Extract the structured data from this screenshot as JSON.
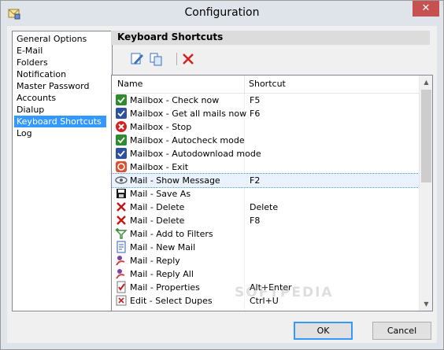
{
  "window": {
    "title": "Configuration",
    "close_glyph": "✕"
  },
  "nav": {
    "items": [
      {
        "label": "General Options",
        "selected": false
      },
      {
        "label": "E-Mail",
        "selected": false
      },
      {
        "label": "Folders",
        "selected": false
      },
      {
        "label": "Notification",
        "selected": false
      },
      {
        "label": "Master Password",
        "selected": false
      },
      {
        "label": "Accounts",
        "selected": false
      },
      {
        "label": "Dialup",
        "selected": false
      },
      {
        "label": "Keyboard Shortcuts",
        "selected": true
      },
      {
        "label": "Log",
        "selected": false
      }
    ]
  },
  "section": {
    "title": "Keyboard Shortcuts"
  },
  "toolbar": {
    "edit_icon": "edit-icon",
    "copy_icon": "copy-icon",
    "delete_icon": "delete-icon"
  },
  "table": {
    "columns": [
      "Name",
      "Shortcut"
    ],
    "rows": [
      {
        "name": "Mailbox - Check now",
        "shortcut": "F5",
        "icon": "check-mail-icon",
        "color": "#2e8b2e"
      },
      {
        "name": "Mailbox - Get all mails now",
        "shortcut": "F6",
        "icon": "get-mail-icon",
        "color": "#2f4f9f"
      },
      {
        "name": "Mailbox - Stop",
        "shortcut": "",
        "icon": "stop-icon",
        "color": "#d42020"
      },
      {
        "name": "Mailbox - Autocheck mode",
        "shortcut": "",
        "icon": "autocheck-icon",
        "color": "#2e8b2e"
      },
      {
        "name": "Mailbox - Autodownload mode",
        "shortcut": "",
        "icon": "autodownload-icon",
        "color": "#2f4f9f"
      },
      {
        "name": "Mailbox - Exit",
        "shortcut": "",
        "icon": "exit-icon",
        "color": "#e05030"
      },
      {
        "name": "Mail - Show Message",
        "shortcut": "F2",
        "icon": "show-message-icon",
        "color": "#606060",
        "focused": true
      },
      {
        "name": "Mail - Save As",
        "shortcut": "",
        "icon": "save-icon",
        "color": "#1a1a1a"
      },
      {
        "name": "Mail - Delete",
        "shortcut": "Delete",
        "icon": "delete-icon",
        "color": "#c01818"
      },
      {
        "name": "Mail - Delete",
        "shortcut": "F8",
        "icon": "delete-icon",
        "color": "#c01818"
      },
      {
        "name": "Mail - Add to Filters",
        "shortcut": "",
        "icon": "filter-icon",
        "color": "#3a8a3a"
      },
      {
        "name": "Mail - New Mail",
        "shortcut": "",
        "icon": "new-mail-icon",
        "color": "#3060b0"
      },
      {
        "name": "Mail - Reply",
        "shortcut": "",
        "icon": "reply-icon",
        "color": "#8040a0"
      },
      {
        "name": "Mail - Reply All",
        "shortcut": "",
        "icon": "reply-all-icon",
        "color": "#8040a0"
      },
      {
        "name": "Mail - Properties",
        "shortcut": "Alt+Enter",
        "icon": "properties-icon",
        "color": "#c02020"
      },
      {
        "name": "Edit - Select Dupes",
        "shortcut": "Ctrl+U",
        "icon": "select-dupes-icon",
        "color": "#c02020"
      }
    ]
  },
  "buttons": {
    "ok": "OK",
    "cancel": "Cancel"
  },
  "watermark": "SOFTPEDIA"
}
